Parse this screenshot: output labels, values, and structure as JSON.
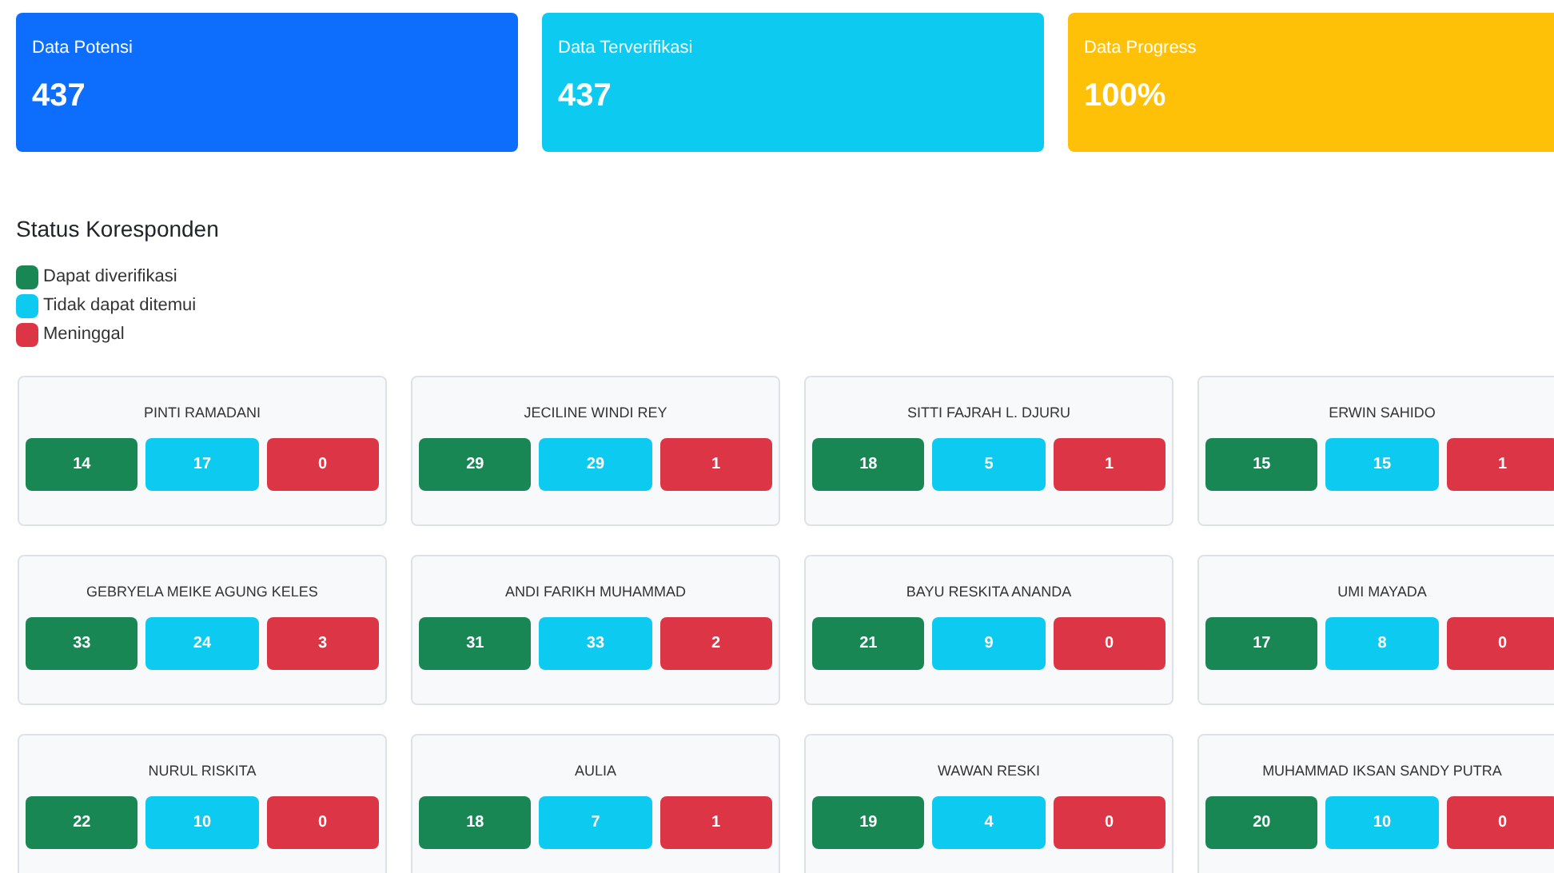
{
  "stats": [
    {
      "label": "Data Potensi",
      "value": "437",
      "color": "#0d6efd"
    },
    {
      "label": "Data Terverifikasi",
      "value": "437",
      "color": "#0dcaf0"
    },
    {
      "label": "Data Progress",
      "value": "100%",
      "color": "#ffc107"
    }
  ],
  "status_title": "Status Koresponden",
  "legend": [
    {
      "label": "Dapat diverifikasi",
      "color": "#198754"
    },
    {
      "label": "Tidak dapat ditemui",
      "color": "#0dcaf0"
    },
    {
      "label": "Meninggal",
      "color": "#dc3545"
    }
  ],
  "respondents": [
    {
      "name": "PINTI RAMADANI",
      "counts": [
        {
          "kind": "verified",
          "value": "14"
        },
        {
          "kind": "unreachable",
          "value": "17"
        },
        {
          "kind": "deceased",
          "value": "0"
        }
      ]
    },
    {
      "name": "JECILINE WINDI REY",
      "counts": [
        {
          "kind": "verified",
          "value": "29"
        },
        {
          "kind": "unreachable",
          "value": "29"
        },
        {
          "kind": "deceased",
          "value": "1"
        }
      ]
    },
    {
      "name": "SITTI FAJRAH L. DJURU",
      "counts": [
        {
          "kind": "verified",
          "value": "18"
        },
        {
          "kind": "unreachable",
          "value": "5"
        },
        {
          "kind": "deceased",
          "value": "1"
        }
      ]
    },
    {
      "name": "ERWIN SAHIDO",
      "counts": [
        {
          "kind": "verified",
          "value": "15"
        },
        {
          "kind": "unreachable",
          "value": "15"
        },
        {
          "kind": "deceased",
          "value": "1"
        }
      ]
    },
    {
      "name": "GEBRYELA MEIKE AGUNG KELES",
      "counts": [
        {
          "kind": "verified",
          "value": "33"
        },
        {
          "kind": "unreachable",
          "value": "24"
        },
        {
          "kind": "deceased",
          "value": "3"
        }
      ]
    },
    {
      "name": "ANDI FARIKH MUHAMMAD",
      "counts": [
        {
          "kind": "verified",
          "value": "31"
        },
        {
          "kind": "unreachable",
          "value": "33"
        },
        {
          "kind": "deceased",
          "value": "2"
        }
      ]
    },
    {
      "name": "BAYU RESKITA ANANDA",
      "counts": [
        {
          "kind": "verified",
          "value": "21"
        },
        {
          "kind": "unreachable",
          "value": "9"
        },
        {
          "kind": "deceased",
          "value": "0"
        }
      ]
    },
    {
      "name": "UMI MAYADA",
      "counts": [
        {
          "kind": "verified",
          "value": "17"
        },
        {
          "kind": "unreachable",
          "value": "8"
        },
        {
          "kind": "deceased",
          "value": "0"
        }
      ]
    },
    {
      "name": "NURUL RISKITA",
      "counts": [
        {
          "kind": "verified",
          "value": "22"
        },
        {
          "kind": "unreachable",
          "value": "10"
        },
        {
          "kind": "deceased",
          "value": "0"
        }
      ]
    },
    {
      "name": "AULIA",
      "counts": [
        {
          "kind": "verified",
          "value": "18"
        },
        {
          "kind": "unreachable",
          "value": "7"
        },
        {
          "kind": "deceased",
          "value": "1"
        }
      ]
    },
    {
      "name": "WAWAN RESKI",
      "counts": [
        {
          "kind": "verified",
          "value": "19"
        },
        {
          "kind": "unreachable",
          "value": "4"
        },
        {
          "kind": "deceased",
          "value": "0"
        }
      ]
    },
    {
      "name": "MUHAMMAD IKSAN SANDY PUTRA",
      "counts": [
        {
          "kind": "verified",
          "value": "20"
        },
        {
          "kind": "unreachable",
          "value": "10"
        },
        {
          "kind": "deceased",
          "value": "0"
        }
      ]
    }
  ]
}
